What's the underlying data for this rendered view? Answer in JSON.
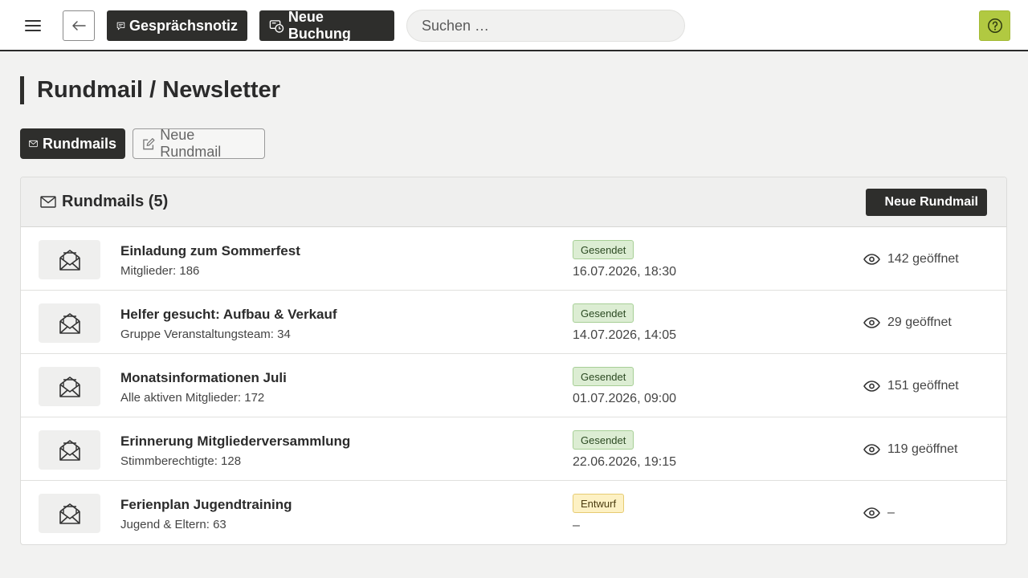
{
  "topbar": {
    "menu_icon": "hamburger-icon",
    "back_icon": "arrow-left-icon",
    "note_button_label": "Gesprächsnotiz",
    "booking_button_label": "Neue Buchung",
    "search_placeholder": "Suchen …",
    "help_icon": "help-icon",
    "accent_color": "#b1c941"
  },
  "page": {
    "title": "Rundmail / Newsletter"
  },
  "tabs": [
    {
      "label": "Rundmails",
      "icon": "mail-icon",
      "active": true
    },
    {
      "label": "Neue Rundmail",
      "icon": "edit-icon",
      "active": false
    }
  ],
  "panel": {
    "title": "Rundmails (5)",
    "new_button_label": "Neue Rundmail"
  },
  "mails": [
    {
      "title": "Einladung zum Sommerfest",
      "recipients": "Mitglieder: 186",
      "status": "Gesendet",
      "date": "16.07.2026, 18:30",
      "opened": "142 geöffnet"
    },
    {
      "title": "Helfer gesucht: Aufbau & Verkauf",
      "recipients": "Gruppe Veranstaltungsteam: 34",
      "status": "Gesendet",
      "date": "14.07.2026, 14:05",
      "opened": "29 geöffnet"
    },
    {
      "title": "Monatsinformationen Juli",
      "recipients": "Alle aktiven Mitglieder: 172",
      "status": "Gesendet",
      "date": "01.07.2026, 09:00",
      "opened": "151 geöffnet"
    },
    {
      "title": "Erinnerung Mitgliederversammlung",
      "recipients": "Stimmberechtigte: 128",
      "status": "Gesendet",
      "date": "22.06.2026, 19:15",
      "opened": "119 geöffnet"
    },
    {
      "title": "Ferienplan Jugendtraining",
      "recipients": "Jugend & Eltern: 63",
      "status": "Entwurf",
      "date": "–",
      "opened": "–"
    }
  ],
  "status_colors": {
    "Gesendet": "#dcedd3",
    "Entwurf": "#fdf1c4"
  }
}
